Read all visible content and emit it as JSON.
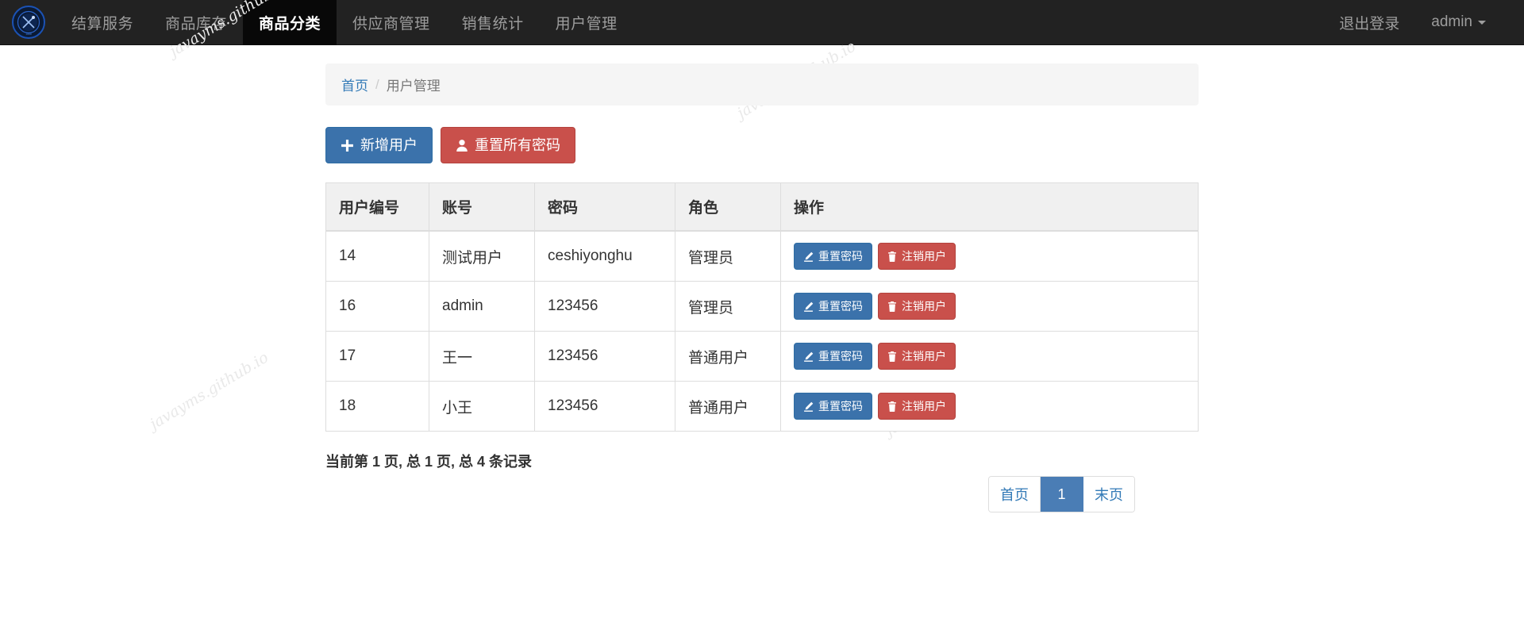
{
  "navbar": {
    "brand_icon": "university-seal-logo",
    "items": [
      {
        "label": "结算服务",
        "active": false
      },
      {
        "label": "商品库存",
        "active": false
      },
      {
        "label": "商品分类",
        "active": true
      },
      {
        "label": "供应商管理",
        "active": false
      },
      {
        "label": "销售统计",
        "active": false
      },
      {
        "label": "用户管理",
        "active": false
      }
    ],
    "logout_label": "退出登录",
    "user_label": "admin"
  },
  "breadcrumb": {
    "home": "首页",
    "separator": "/",
    "current": "用户管理"
  },
  "toolbar": {
    "add_user_label": "新增用户",
    "add_user_icon": "plus-icon",
    "reset_all_label": "重置所有密码",
    "reset_all_icon": "user-icon"
  },
  "table": {
    "headers": [
      "用户编号",
      "账号",
      "密码",
      "角色",
      "操作"
    ],
    "row_actions": {
      "reset_label": "重置密码",
      "reset_icon": "pencil-icon",
      "delete_label": "注销用户",
      "delete_icon": "trash-icon"
    },
    "rows": [
      {
        "id": "14",
        "account": "测试用户",
        "password": "ceshiyonghu",
        "role": "管理员"
      },
      {
        "id": "16",
        "account": "admin",
        "password": "123456",
        "role": "管理员"
      },
      {
        "id": "17",
        "account": "王一",
        "password": "123456",
        "role": "普通用户"
      },
      {
        "id": "18",
        "account": "小王",
        "password": "123456",
        "role": "普通用户"
      }
    ]
  },
  "pagination": {
    "info": "当前第 1 页, 总 1 页, 总 4 条记录",
    "first_label": "首页",
    "current_page": "1",
    "last_label": "末页"
  },
  "watermark": {
    "text": "javayms.github.io"
  },
  "colors": {
    "navbar_bg": "#222222",
    "nav_link": "#9d9d9d",
    "nav_active": "#ffffff",
    "primary": "#3b72ab",
    "danger": "#c9504b",
    "link": "#337ab7",
    "pager_active": "#4a7db5",
    "header_bg": "#f0f0f0",
    "breadcrumb_bg": "#f5f5f5"
  }
}
